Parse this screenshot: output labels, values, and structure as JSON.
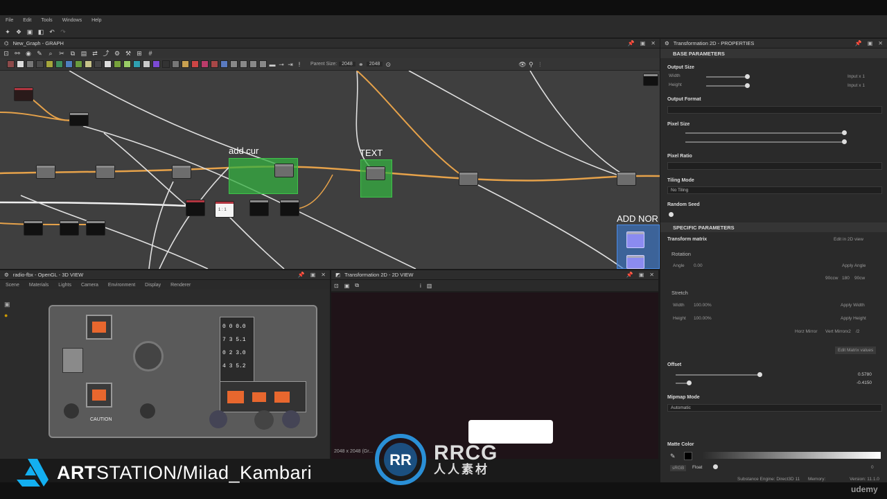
{
  "menu": [
    "File",
    "Edit",
    "Tools",
    "Windows",
    "Help"
  ],
  "graph": {
    "title": "New_Graph - GRAPH",
    "parent_size_label": "Parent Size:",
    "parent_size_value": "2048",
    "size_value2": "2048",
    "frames": [
      {
        "label": "add cur"
      },
      {
        "label": "TEXT"
      },
      {
        "label": "ADD NOR"
      }
    ],
    "node_text": "1 : 1"
  },
  "view3d": {
    "title": "radio-fbx - OpenGL - 3D VIEW",
    "tabs": [
      "Scene",
      "Materials",
      "Lights",
      "Camera",
      "Environment",
      "Display",
      "Renderer"
    ],
    "panel_counters": [
      "0 0 0.0",
      "7 3 5.1",
      "0 2 3.0",
      "4 3 5.2"
    ],
    "caution": "CAUTION"
  },
  "view2d": {
    "title": "Transformation 2D - 2D VIEW",
    "resolution": "2048 x 2048 (Gr..."
  },
  "props": {
    "title": "Transformation 2D - PROPERTIES",
    "base_params": "BASE PARAMETERS",
    "output_size": "Output Size",
    "width": "Width",
    "height": "Height",
    "input_x1_a": "Input x 1",
    "input_x1_b": "Input x 1",
    "output_format": "Output Format",
    "pixel_size": "Pixel Size",
    "pixel_ratio": "Pixel Ratio",
    "tiling_mode": "Tiling Mode",
    "tiling_value": "No Tiling",
    "random_seed": "Random Seed",
    "specific_params": "SPECIFIC PARAMETERS",
    "transform_matrix": "Transform matrix",
    "edit_in_2d": "Edit in 2D view",
    "rotation": "Rotation",
    "angle": "Angle",
    "angle_value": "0.00",
    "apply_angle": "Apply Angle",
    "rot_buttons": [
      "90ccw",
      "180",
      "90cw"
    ],
    "stretch": "Stretch",
    "stretch_width": "Width",
    "stretch_width_val": "100.00%",
    "apply_width": "Apply Width",
    "stretch_height": "Height",
    "stretch_height_val": "100.00%",
    "apply_height": "Apply Height",
    "mirror": [
      "Horz Mirror",
      "Vert Mirror",
      "x2",
      "/2"
    ],
    "edit_matrix": "Edit Matrix values",
    "offset": "Offset",
    "offset_x": "0.5780",
    "offset_y": "-0.4150",
    "mipmap_mode": "Mipmap Mode",
    "mipmap_value": "Automatic",
    "matte_color": "Matte Color",
    "float_label": "Float",
    "float_val": "0",
    "srgb": "sRGB"
  },
  "status": {
    "engine": "Substance Engine: Direct3D 11",
    "memory": "Memory:",
    "version": "Version: 11.1.0"
  },
  "watermarks": {
    "artstation_bold": "ART",
    "artstation_rest": "STATION/Milad_Kambari",
    "rrcg": "RRCG",
    "rrcg_cn": "人人素材",
    "udemy": "udemy"
  },
  "colors": {
    "frame_green": "#36b042",
    "node_red": "#b13540",
    "wire_orange": "#e6a24a",
    "wire_white": "#e8e8e8",
    "frame_blue": "#3a7bd5"
  }
}
